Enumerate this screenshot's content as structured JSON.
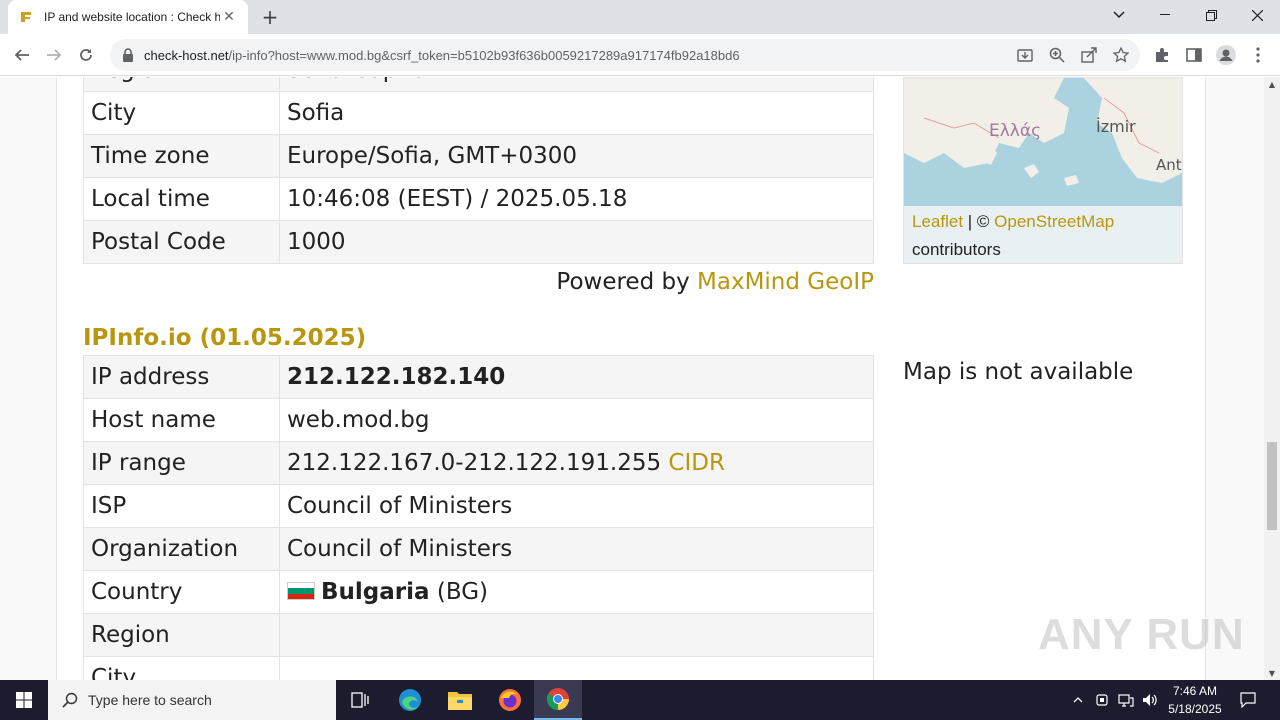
{
  "browser": {
    "tab_title": "IP and website location : Check h",
    "tab_close": "✕",
    "new_tab": "+",
    "url_host": "check-host.net",
    "url_path": "/ip-info?host=www.mod.bg&csrf_token=b5102b93f636b0059217289a917174fb92a18bd6"
  },
  "geo_table_1": {
    "rows": [
      {
        "key": "Region",
        "value": "Sofia-Capital"
      },
      {
        "key": "City",
        "value": "Sofia"
      },
      {
        "key": "Time zone",
        "value": "Europe/Sofia, GMT+0300"
      },
      {
        "key": "Local time",
        "value": "10:46:08 (EEST) / 2025.05.18"
      },
      {
        "key": "Postal Code",
        "value": "1000"
      }
    ],
    "powered_prefix": "Powered by ",
    "powered_link": "MaxMind GeoIP"
  },
  "map": {
    "label_greece": "Ελλάς",
    "label_izmir": "İzmir",
    "label_ant": "Ant",
    "credit_leaflet": "Leaflet",
    "credit_sep": " | © ",
    "credit_osm": "OpenStreetMap",
    "credit_contributors": "contributors"
  },
  "ipinfo": {
    "title": "IPInfo.io (01.05.2025)",
    "rows": {
      "ip_key": "IP address",
      "ip_value": "212.122.182.140",
      "host_key": "Host name",
      "host_value": "web.mod.bg",
      "range_key": "IP range",
      "range_value": "212.122.167.0-212.122.191.255 ",
      "range_link": "CIDR",
      "isp_key": "ISP",
      "isp_value": "Council of Ministers",
      "org_key": "Organization",
      "org_value": "Council of Ministers",
      "country_key": "Country",
      "country_value": "Bulgaria",
      "country_code": " (BG)",
      "region_key": "Region",
      "region_value": "",
      "city_key": "City",
      "city_value": ""
    },
    "no_map": "Map is not available"
  },
  "watermark": "ANY RUN",
  "taskbar": {
    "search_placeholder": "Type here to search",
    "time": "7:46 AM",
    "date": "5/18/2025"
  },
  "colors": {
    "accent_gold": "#b8970f",
    "taskbar": "#1c1c2e"
  }
}
